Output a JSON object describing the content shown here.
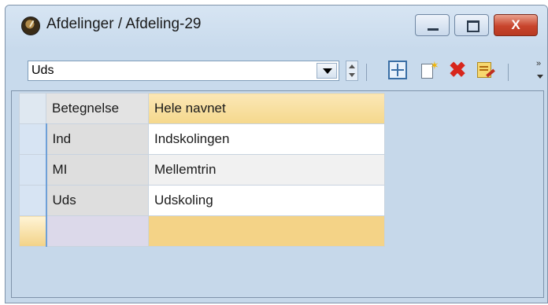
{
  "window": {
    "title": "Afdelinger / Afdeling-29",
    "buttons": {
      "minimize": "minimize",
      "maximize": "maximize",
      "close": "X"
    }
  },
  "toolbar": {
    "combo_value": "Uds",
    "icons": [
      "grid-icon",
      "new-record-icon",
      "delete-icon",
      "edit-icon"
    ]
  },
  "grid": {
    "columns": [
      "Betegnelse",
      "Hele navnet"
    ],
    "rows": [
      {
        "code": "Ind",
        "name": "Indskolingen"
      },
      {
        "code": "MI",
        "name": "Mellemtrin"
      },
      {
        "code": "Uds",
        "name": "Udskoling"
      }
    ]
  },
  "colors": {
    "window_bg": "#c6d8ea",
    "header_highlight": "#f5d88c",
    "close_button": "#c8442c"
  }
}
